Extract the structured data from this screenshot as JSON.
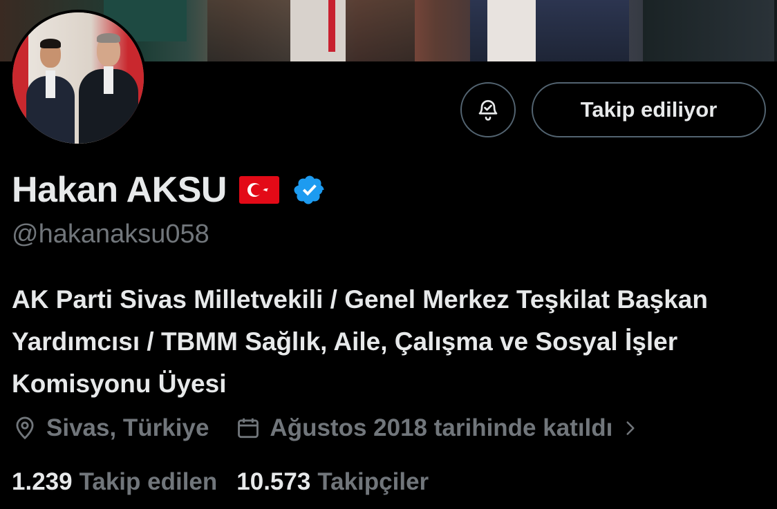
{
  "profile": {
    "name": "Hakan AKSU",
    "handle": "@hakanaksu058",
    "flag_emoji_alt": "Turkey flag",
    "verified_color": "#1d9bf0",
    "bio": "AK Parti Sivas Milletvekili / Genel Merkez Teşkilat Başkan Yardımcısı / TBMM Sağlık, Aile, Çalışma ve Sosyal İşler Komisyonu Üyesi",
    "location": "Sivas, Türkiye",
    "joined": "Ağustos 2018 tarihinde katıldı"
  },
  "actions": {
    "notify_icon": "bell-check-icon",
    "follow_label": "Takip ediliyor"
  },
  "stats": {
    "following_count": "1.239",
    "following_label": "Takip edilen",
    "followers_count": "10.573",
    "followers_label": "Takipçiler"
  },
  "colors": {
    "background": "#000000",
    "text": "#e7e9ea",
    "muted": "#71767b",
    "border": "#536471",
    "flag_red": "#e30a17"
  }
}
